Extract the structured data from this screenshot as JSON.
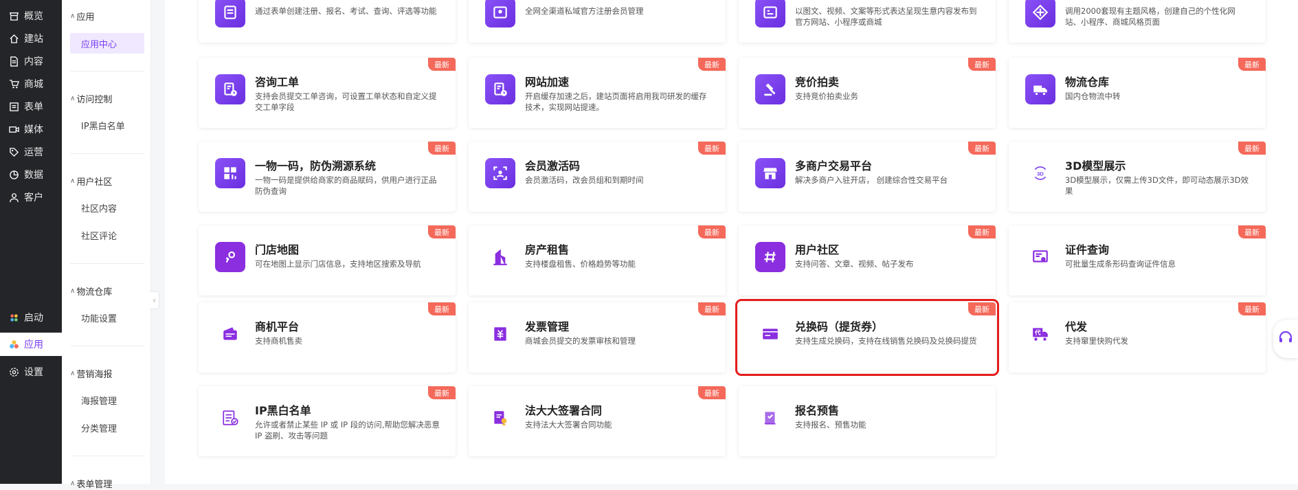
{
  "nav": {
    "items": [
      {
        "label": "概览",
        "icon": "store-icon"
      },
      {
        "label": "建站",
        "icon": "home-icon"
      },
      {
        "label": "内容",
        "icon": "document-icon"
      },
      {
        "label": "商城",
        "icon": "cart-icon"
      },
      {
        "label": "表单",
        "icon": "form-icon"
      },
      {
        "label": "媒体",
        "icon": "video-icon"
      },
      {
        "label": "运营",
        "icon": "tag-icon"
      },
      {
        "label": "数据",
        "icon": "chart-pie-icon"
      },
      {
        "label": "客户",
        "icon": "user-icon"
      }
    ],
    "bottom": [
      {
        "label": "启动",
        "icon": "launch-icon"
      },
      {
        "label": "应用",
        "icon": "apps-icon"
      },
      {
        "label": "设置",
        "icon": "gear-icon"
      }
    ]
  },
  "submenu": {
    "groups": [
      {
        "label": "应用",
        "items": [
          "应用中心"
        ]
      },
      {
        "label": "访问控制",
        "items": [
          "IP黑白名单"
        ]
      },
      {
        "label": "用户社区",
        "items": [
          "社区内容",
          "社区评论"
        ]
      },
      {
        "label": "物流仓库",
        "items": [
          "功能设置"
        ]
      },
      {
        "label": "营销海报",
        "items": [
          "海报管理",
          "分类管理"
        ]
      },
      {
        "label": "表单管理",
        "items": []
      }
    ]
  },
  "badge": "最新",
  "cards_top": [
    {
      "desc": "通过表单创建注册、报名、考试、查询、评选等功能"
    },
    {
      "desc": "全网全渠道私域官方注册会员管理"
    },
    {
      "desc": "以图文、视频、文案等形式表达呈现生意内容发布到官方网站、小程序或商城"
    },
    {
      "desc": "调用2000套现有主题风格，创建自己的个性化网站、小程序、商城风格页面"
    }
  ],
  "cards": [
    {
      "title": "咨询工单",
      "desc": "支持会员提交工单咨询，可设置工单状态和自定义提交工单字段",
      "icon": "ticket-icon"
    },
    {
      "title": "网站加速",
      "desc": "开启缓存加速之后，建站页面将启用我司研发的缓存技术，实现网站提速。",
      "icon": "speed-icon"
    },
    {
      "title": "竞价拍卖",
      "desc": "支持竞价拍卖业务",
      "icon": "gavel-icon"
    },
    {
      "title": "物流仓库",
      "desc": "国内仓物流中转",
      "icon": "truck-icon"
    },
    {
      "title": "一物一码，防伪溯源系统",
      "desc": "一物一码是提供给商家的商品赋码，供用户进行正品防伪查询",
      "icon": "qrcode-icon"
    },
    {
      "title": "会员激活码",
      "desc": "会员激活码，改会员组和到期时间",
      "icon": "scan-icon"
    },
    {
      "title": "多商户交易平台",
      "desc": "解决多商户入驻开店， 创建综合性交易平台",
      "icon": "shop-icon"
    },
    {
      "title": "3D模型展示",
      "desc": "3D模型展示，仅需上传3D文件，即可动态展示3D效果",
      "icon": "3d-icon"
    },
    {
      "title": "门店地图",
      "desc": "可在地图上显示门店信息，支持地区搜索及导航",
      "icon": "map-pin-icon"
    },
    {
      "title": "房产租售",
      "desc": "支持楼盘租售、价格趋势等功能",
      "icon": "building-icon"
    },
    {
      "title": "用户社区",
      "desc": "支持问答、文章、视频、帖子发布",
      "icon": "hashtag-icon"
    },
    {
      "title": "证件查询",
      "desc": "可批量生成条形码查询证件信息",
      "icon": "certificate-icon"
    },
    {
      "title": "商机平台",
      "desc": "支持商机售卖",
      "icon": "wallet-icon"
    },
    {
      "title": "发票管理",
      "desc": "商城会员提交的发票审核和管理",
      "icon": "invoice-icon"
    },
    {
      "title": "兑换码（提货券）",
      "desc": "支持生成兑换码，支持在线销售兑换码及兑换码提货",
      "icon": "card-icon"
    },
    {
      "title": "代发",
      "desc": "支持窜里快购代发",
      "icon": "delivery-icon"
    },
    {
      "title": "IP黑白名单",
      "desc": "允许或者禁止某些 IP 或 IP 段的访问,帮助您解决恶意 IP 盗刷、攻击等问题",
      "icon": "list-check-icon"
    },
    {
      "title": "法大大签署合同",
      "desc": "支持法大大签署合同功能",
      "icon": "contract-icon"
    },
    {
      "title": "报名预售",
      "desc": "支持报名、预售功能",
      "icon": "book-icon"
    }
  ],
  "colors": {
    "accent": "#7b3ff2",
    "badge": "#f4695a",
    "highlight": "#e41c1c",
    "sidebar": "#232528"
  }
}
